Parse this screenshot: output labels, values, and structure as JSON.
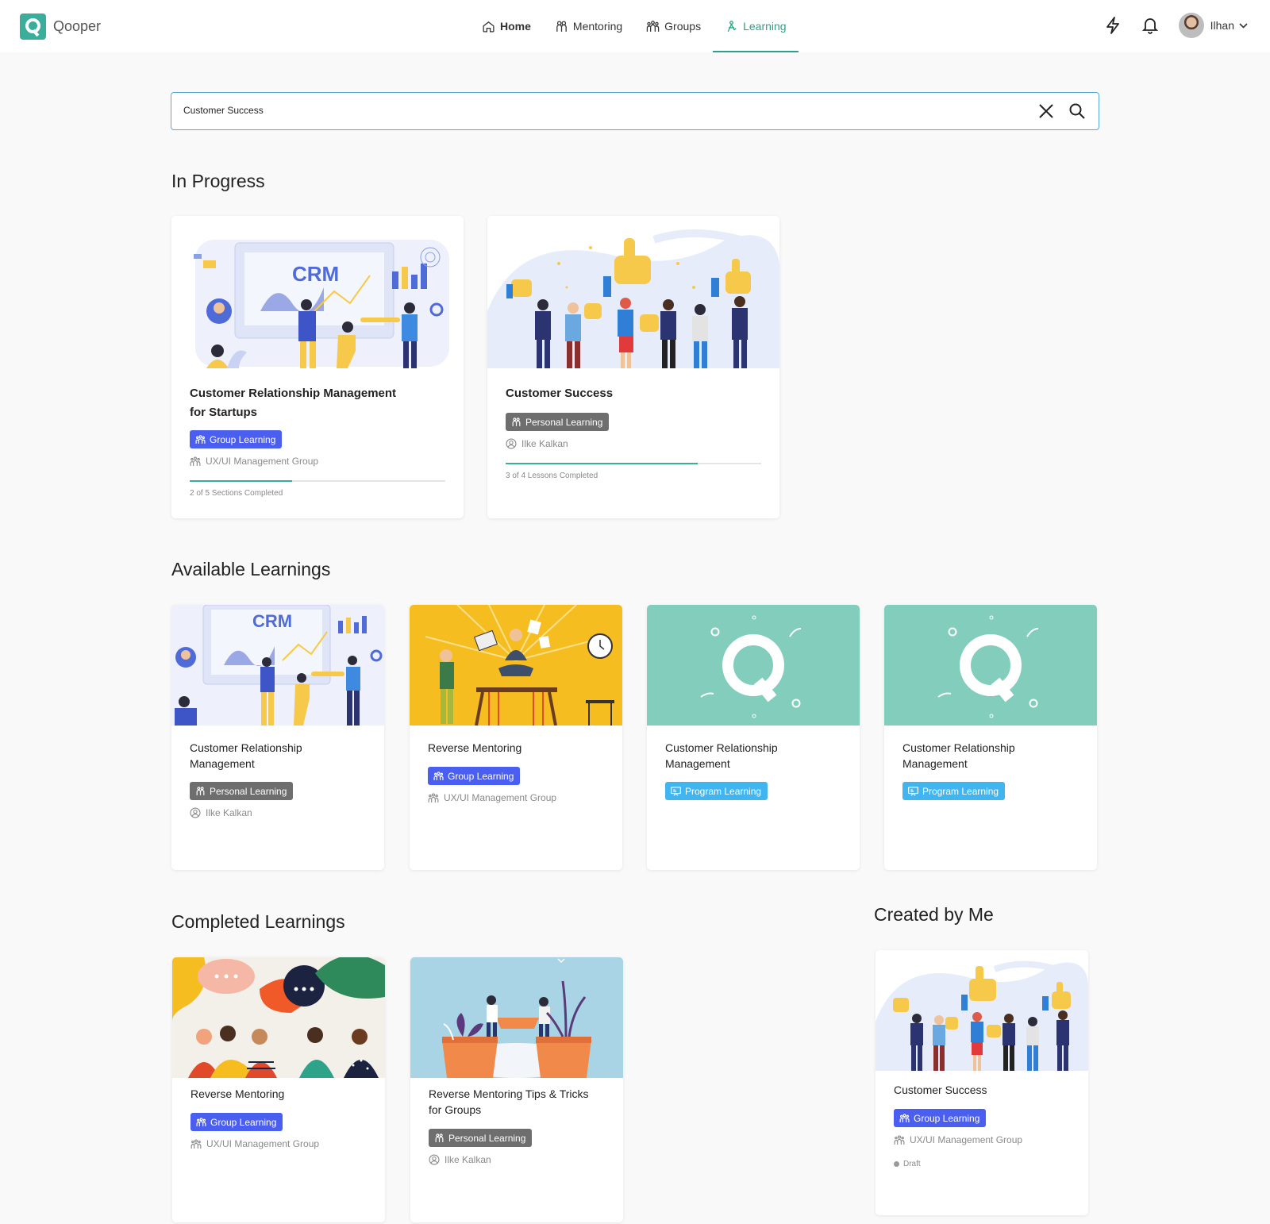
{
  "app": {
    "name": "Qooper"
  },
  "nav": [
    {
      "label": "Home",
      "icon": "home-icon",
      "active": false
    },
    {
      "label": "Mentoring",
      "icon": "mentoring-icon",
      "active": false
    },
    {
      "label": "Groups",
      "icon": "groups-icon",
      "active": false
    },
    {
      "label": "Learning",
      "icon": "learning-icon",
      "active": true
    }
  ],
  "user": {
    "name": "Ilhan"
  },
  "search": {
    "value": "Customer Success"
  },
  "sections": {
    "in_progress": "In Progress",
    "available": "Available Learnings",
    "completed": "Completed Learnings",
    "created": "Created by Me"
  },
  "in_progress": [
    {
      "title_line1": "Customer Relationship Management",
      "title_line2": "for Startups",
      "chip": "Group Learning",
      "meta": "UX/UI Management Group",
      "progress": 0.4,
      "progress_label": "2 of 5 Sections Completed"
    },
    {
      "title_line1": "Customer Success",
      "chip": "Personal Learning",
      "meta": "Ilke Kalkan",
      "progress": 0.75,
      "progress_label": "3 of 4 Lessons Completed"
    }
  ],
  "available": [
    {
      "title_line1": "Customer Relationship",
      "title_line2": "Management",
      "chip": "Personal Learning",
      "meta": "Ilke Kalkan"
    },
    {
      "title_line1": "Reverse Mentoring",
      "chip": "Group Learning",
      "meta": "UX/UI Management Group"
    },
    {
      "title_line1": "Customer Relationship",
      "title_line2": "Management",
      "chip": "Program Learning"
    },
    {
      "title_line1": "Customer Relationship",
      "title_line2": "Management",
      "chip": "Program Learning"
    }
  ],
  "completed": [
    {
      "title_line1": "Reverse Mentoring",
      "chip": "Group Learning",
      "meta": "UX/UI Management Group"
    },
    {
      "title_line1": "Reverse Mentoring Tips & Tricks",
      "title_line2": "for Groups",
      "chip": "Personal Learning",
      "meta": "Ilke Kalkan"
    }
  ],
  "created": [
    {
      "title_line1": "Customer Success",
      "chip": "Group Learning",
      "meta": "UX/UI Management Group",
      "status": "Draft"
    }
  ],
  "colors": {
    "accent": "#3aae9a",
    "group_chip": "#4a5ff0",
    "personal_chip": "#6e6e6e",
    "program_chip": "#41b5f0"
  }
}
